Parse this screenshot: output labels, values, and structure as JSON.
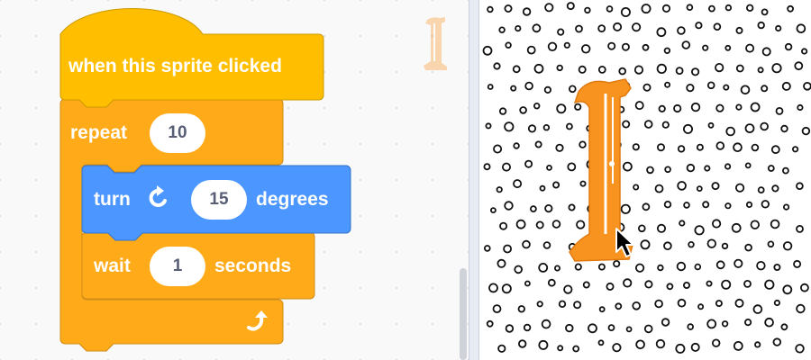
{
  "colors": {
    "events": "#ffbf00",
    "control": "#ffab19",
    "motion": "#4c97ff",
    "sprite": "#f7931e"
  },
  "script": {
    "hat_block": {
      "label": "when this sprite clicked"
    },
    "repeat_block": {
      "label": "repeat",
      "count": "10",
      "loop_arrow_icon": "loop-arrow-icon"
    },
    "turn_block": {
      "label": "turn",
      "direction_icon": "rotate-clockwise-icon",
      "value": "15",
      "unit": "degrees"
    },
    "wait_block": {
      "label": "wait",
      "value": "1",
      "unit": "seconds"
    }
  },
  "stage": {
    "backdrop": "polka-dots",
    "sprite": "letter-I-sprite",
    "cursor": "arrow-cursor-icon"
  }
}
